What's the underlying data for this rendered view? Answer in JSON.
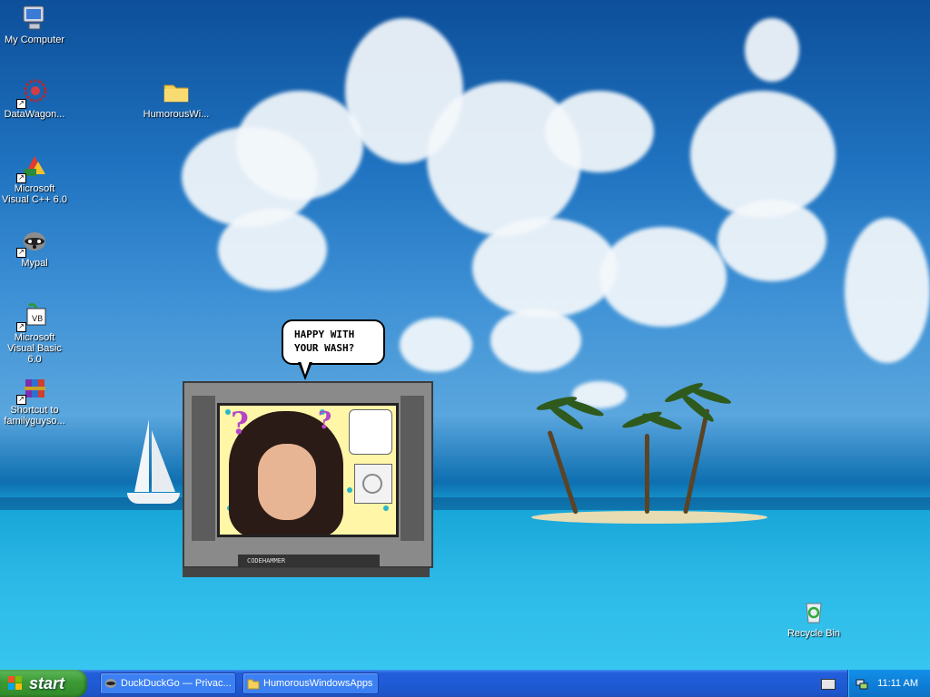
{
  "desktop": {
    "icons": [
      {
        "label": "My Computer",
        "icon": "my-computer-icon",
        "shortcut": false
      },
      {
        "label": "DataWagon...",
        "icon": "datawagon-icon",
        "shortcut": true
      },
      {
        "label": "HumorousWi...",
        "icon": "folder-icon",
        "shortcut": false
      },
      {
        "label": "Microsoft Visual C++ 6.0",
        "icon": "visual-cpp-icon",
        "shortcut": true
      },
      {
        "label": "Mypal",
        "icon": "mypal-raccoon-icon",
        "shortcut": true
      },
      {
        "label": "Microsoft Visual Basic 6.0",
        "icon": "visual-basic-icon",
        "shortcut": true
      },
      {
        "label": "Shortcut to familyguyso...",
        "icon": "winrar-archive-icon",
        "shortcut": true
      },
      {
        "label": "Recycle Bin",
        "icon": "recycle-bin-icon",
        "shortcut": false
      }
    ]
  },
  "agent": {
    "speech_line1": "HAPPY WITH",
    "speech_line2": "YOUR WASH?",
    "brand": "CODEHAMMER"
  },
  "taskbar": {
    "start_label": "start",
    "tasks": [
      {
        "label": "DuckDuckGo — Privac...",
        "icon": "mypal-browser-icon"
      },
      {
        "label": "HumorousWindowsApps",
        "icon": "folder-icon"
      }
    ],
    "clock": "11:11 AM"
  },
  "colors": {
    "taskbar_blue": "#245edb",
    "start_green": "#3c9a34",
    "tray_blue": "#0f7fd9"
  }
}
